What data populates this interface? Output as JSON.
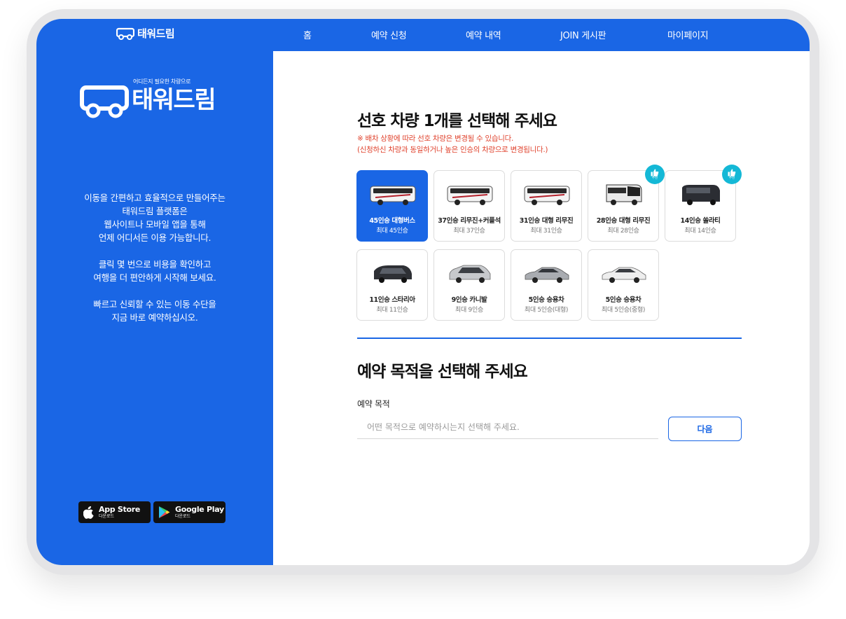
{
  "header": {
    "logo_text": "태워드림",
    "nav": [
      "홈",
      "예약 신청",
      "예약 내역",
      "JOIN 게시판",
      "마이페이지"
    ]
  },
  "sidebar": {
    "tagline": "어디든지 필요한 차량으로",
    "logo_text": "태워드림",
    "paragraphs": [
      "이동을 간편하고 효율적으로 만들어주는\n태워드림 플랫폼은\n웹사이트나 모바일 앱을 통해\n언제 어디서든 이용 가능합니다.",
      "클릭 몇 번으로 비용을 확인하고\n여행을 더 편안하게 시작해 보세요.",
      "빠르고 신뢰할 수 있는 이동 수단을\n지금 바로 예약하십시오."
    ],
    "app_store": {
      "label": "App Store",
      "sub": "다운로드"
    },
    "google_play": {
      "label": "Google Play",
      "sub": "다운로드"
    }
  },
  "vehicle_section": {
    "title": "선호 차량 1개를 선택해 주세요",
    "notice_1": "※ 배차 상황에 따라 선호 차량은 변경될 수 있습니다.",
    "notice_2": "(신청하신 차량과 동일하거나 높은 인승의 차량으로 변경됩니다.)",
    "recommend_label": "추천",
    "vehicles": [
      {
        "name": "45인승 대형버스",
        "capacity": "최대 45인승",
        "selected": true,
        "recommended": false,
        "kind": "bus"
      },
      {
        "name": "37인승 리무진+커플석",
        "capacity": "최대 37인승",
        "selected": false,
        "recommended": false,
        "kind": "bus"
      },
      {
        "name": "31인승 대형 리무진",
        "capacity": "최대 31인승",
        "selected": false,
        "recommended": false,
        "kind": "bus"
      },
      {
        "name": "28인승 대형 리무진",
        "capacity": "최대 28인승",
        "selected": false,
        "recommended": true,
        "kind": "coach"
      },
      {
        "name": "14인승 쏠라티",
        "capacity": "최대 14인승",
        "selected": false,
        "recommended": true,
        "kind": "van"
      },
      {
        "name": "11인승 스타리아",
        "capacity": "최대 11인승",
        "selected": false,
        "recommended": false,
        "kind": "minivan"
      },
      {
        "name": "9인승 카니발",
        "capacity": "최대 9인승",
        "selected": false,
        "recommended": false,
        "kind": "suv"
      },
      {
        "name": "5인승 승용차",
        "capacity": "최대 5인승(대형)",
        "selected": false,
        "recommended": false,
        "kind": "sedan"
      },
      {
        "name": "5인승 승용차",
        "capacity": "최대 5인승(중형)",
        "selected": false,
        "recommended": false,
        "kind": "sedan-white"
      }
    ]
  },
  "purpose_section": {
    "title": "예약 목적을 선택해 주세요",
    "field_label": "예약 목적",
    "placeholder": "어떤 목적으로 예약하시는지 선택해 주세요.",
    "next_label": "다음"
  },
  "colors": {
    "primary": "#1a66e5",
    "badge": "#14b8d6",
    "notice": "#e0442f"
  }
}
